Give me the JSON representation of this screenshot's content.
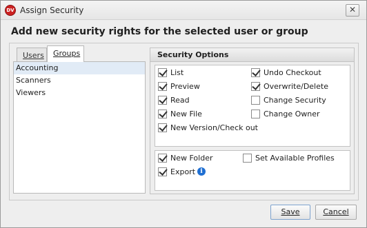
{
  "window": {
    "title": "Assign Security",
    "app_icon_text": "DV",
    "close_glyph": "✕"
  },
  "heading": "Add new security rights for the selected user or group",
  "tabs": [
    {
      "label": "Users",
      "active": false
    },
    {
      "label": "Groups",
      "active": true
    }
  ],
  "groups_list": [
    {
      "label": "Accounting",
      "selected": true
    },
    {
      "label": "Scanners",
      "selected": false
    },
    {
      "label": "Viewers",
      "selected": false
    }
  ],
  "security": {
    "header": "Security Options",
    "options_primary": [
      {
        "label": "List",
        "checked": true
      },
      {
        "label": "Preview",
        "checked": true
      },
      {
        "label": "Read",
        "checked": true
      },
      {
        "label": "New File",
        "checked": true
      },
      {
        "label": "New Version/Check out",
        "checked": true
      },
      {
        "label": "Undo Checkout",
        "checked": true
      },
      {
        "label": "Overwrite/Delete",
        "checked": true
      },
      {
        "label": "Change Security",
        "checked": false
      },
      {
        "label": "Change Owner",
        "checked": false
      }
    ],
    "options_secondary": [
      {
        "label": "New Folder",
        "checked": true
      },
      {
        "label": "Export",
        "checked": true,
        "info_icon": "info-icon"
      },
      {
        "label": "Set Available Profiles",
        "checked": false
      }
    ]
  },
  "buttons": {
    "save_label": "Save",
    "cancel_label": "Cancel"
  },
  "colors": {
    "selection": "#e1ebf6",
    "info_icon": "#1f6fd2",
    "app_icon": "#cc2222"
  }
}
